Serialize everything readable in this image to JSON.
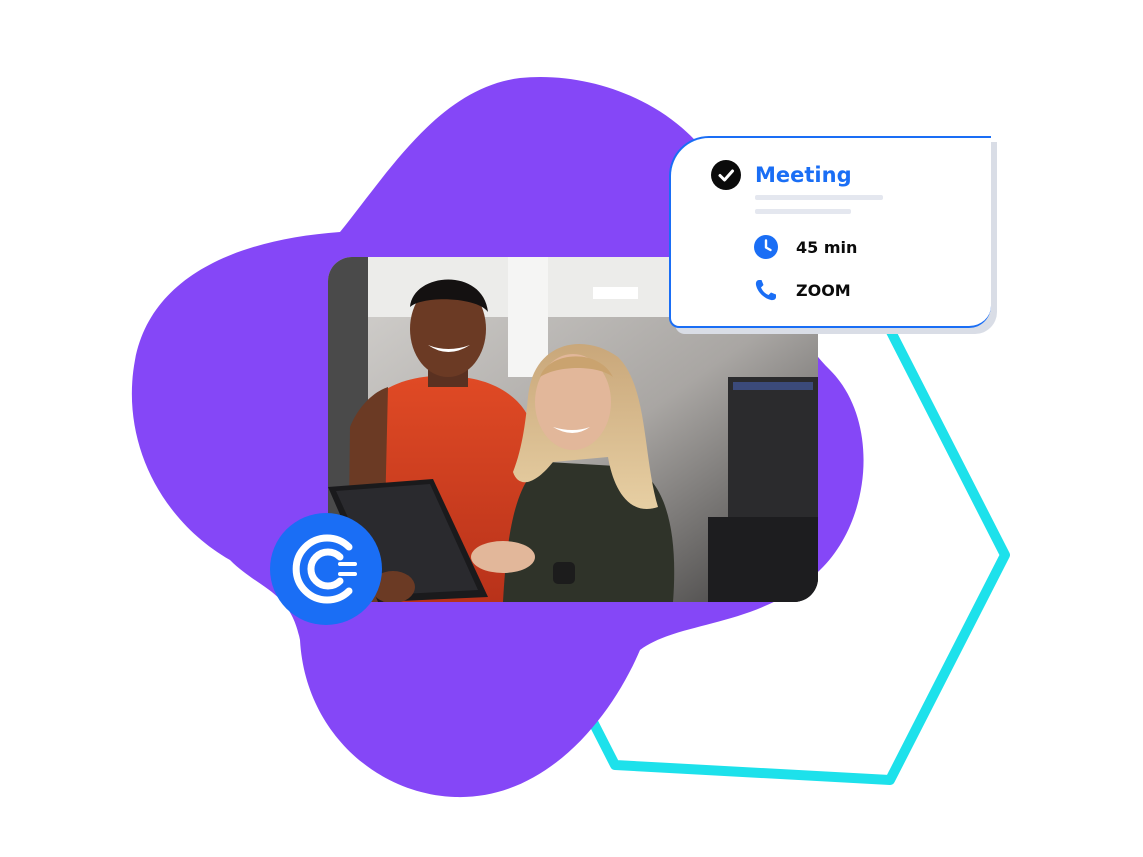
{
  "meeting_card": {
    "title": "Meeting",
    "duration": "45 min",
    "location": "ZOOM",
    "status_icon": "check-circle-icon",
    "duration_icon": "clock-icon",
    "location_icon": "phone-icon"
  },
  "photo": {
    "description_icon": "photo-image"
  },
  "logo": {
    "icon": "calendly-logo-icon"
  },
  "colors": {
    "blob": "#8547f7",
    "hexagon_outline": "#1de1eb",
    "accent_blue": "#1a6ef5",
    "logo_blue": "#1a6ef5"
  }
}
